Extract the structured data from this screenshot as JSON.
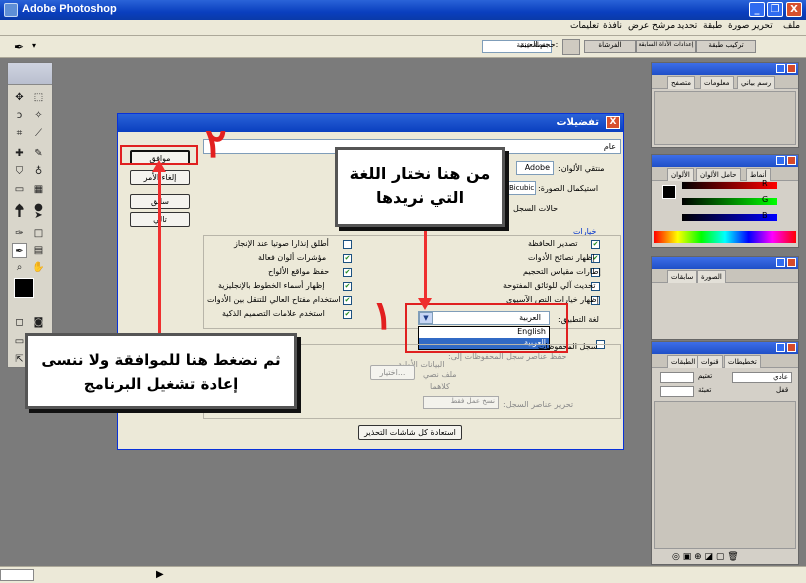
{
  "window": {
    "title": "Adobe Photoshop",
    "min": "_",
    "restore": "❐",
    "close": "X"
  },
  "menu": [
    "ملف",
    "تحرير",
    "صورة",
    "طبقة",
    "تحديد",
    "مرشح",
    "عرض",
    "نافذة",
    "تعليمات"
  ],
  "options": {
    "size_label": "حجم العينة:",
    "size_value": "نقطة عينية",
    "tab1": "الفرشاة",
    "tab2": "إعدادات الأداة السابقة",
    "tab3": "تركيب طبقة"
  },
  "panels": {
    "nav": [
      "رسم بياني",
      "معلومات",
      "متصفح"
    ],
    "color": [
      "الألوان",
      "حامل الألوان",
      "أنماط"
    ],
    "color_labels": [
      "R",
      "G",
      "B"
    ],
    "history": [
      "سابقات",
      "الصورة"
    ],
    "layers": [
      "الطبقات",
      "قنوات",
      "تخطيطات"
    ],
    "layers_field": "عادي",
    "opacity_label": "تعتيم",
    "fill_label": "تعبئة",
    "lock_label": "قفل"
  },
  "dialog": {
    "title": "تفضيلات",
    "close": "X",
    "section": "عام",
    "picker_label": "منتقي الألوان:",
    "picker_value": "Adobe",
    "interp_label": "استيكمال الصورة:",
    "interp_value": "Bicubic",
    "undo_label": "حالات السجل",
    "ok": "موافق",
    "cancel": "إلغاء الأمر",
    "prev": "سابق",
    "next": "تالي",
    "options_title": "خيارات",
    "right_options": [
      {
        "text": "تصدير الحافظة",
        "checked": true
      },
      {
        "text": "إظهار نصائح الأدوات",
        "checked": true
      },
      {
        "text": "إطارات مقياس التحجيم",
        "checked": false
      },
      {
        "text": "تحديث آلي للوثائق المفتوحة",
        "checked": false
      },
      {
        "text": "إظهار خيارات النص الآسيوي",
        "checked": false
      }
    ],
    "left_options": [
      {
        "text": "أطلق إنذارا صوتيا عند الإنجاز",
        "checked": false
      },
      {
        "text": "مؤشرات ألوان فعالة",
        "checked": true
      },
      {
        "text": "حفظ مواقع الألواح",
        "checked": true
      },
      {
        "text": "إظهار أسماء الخطوط بالإنجليزية",
        "checked": true
      },
      {
        "text": "استخدام مفتاح العالي للتنقل بين الأدوات",
        "checked": true
      },
      {
        "text": "استخدم علامات التصميم الذكية",
        "checked": true
      }
    ],
    "lang_label": "لغة التطبيق:",
    "lang_value": "العربية",
    "lang_options": [
      "English",
      "العربية"
    ],
    "history_log": "سجل المحفوظات",
    "save_items": "حفظ عناصر سجل المحفوظات إلى:",
    "meta_label": "البيانات الأولية",
    "text_file": "ملف نصي",
    "both": "كلاهما",
    "choose": "اختيار...",
    "edit_log": "تحرير عناصر السجل:",
    "edit_value": "نسخ عمل فقط",
    "reset": "استعادة كل شاشات التحذير"
  },
  "callouts": {
    "top": "من هنا نختار اللغة التي نريدها",
    "bottom": "ثم نضغط هنا للموافقة ولا ننسى إعادة تشغيل البرنامج",
    "n1": "١",
    "n2": "٢"
  }
}
